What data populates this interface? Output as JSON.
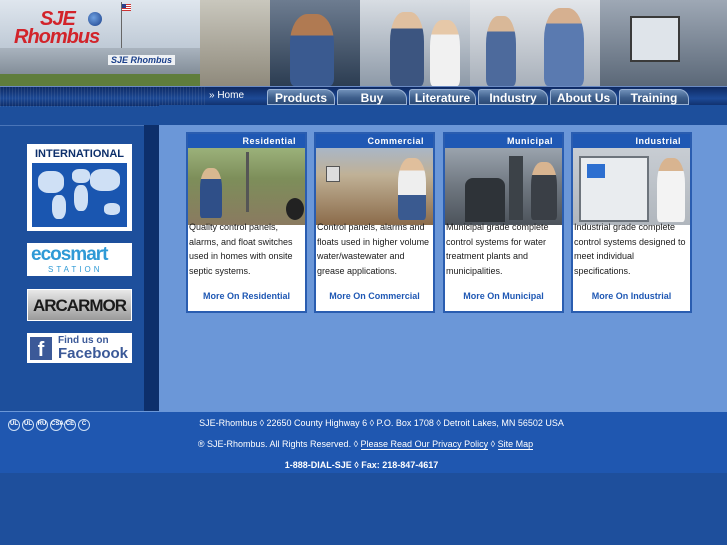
{
  "header": {
    "logo_line1": "SJE",
    "logo_line2": "Rhombus",
    "building_sign": "SJE Rhombus"
  },
  "nav": {
    "home": "» Home",
    "tabs": [
      {
        "label": "Products"
      },
      {
        "label": "Buy"
      },
      {
        "label": "Literature"
      },
      {
        "label": "Industry Info"
      },
      {
        "label": "About Us"
      },
      {
        "label": "Training"
      }
    ]
  },
  "sidebar": {
    "international": "INTERNATIONAL",
    "ecosmart": "ecosmart",
    "ecosmart_sub": "STATION",
    "arcarmor": "ARCARMOR",
    "facebook_f": "f",
    "facebook_findus": "Find us on",
    "facebook_name": "Facebook"
  },
  "cards": [
    {
      "title": "Residential",
      "text": "Quality control panels, alarms, and float switches used in homes with onsite septic systems.",
      "link": "More On Residential"
    },
    {
      "title": "Commercial",
      "text": "Control panels, alarms and floats used in higher volume water/wastewater and grease applications.",
      "link": "More On Commercial"
    },
    {
      "title": "Municipal",
      "text": "Municipal grade complete control systems for water treatment plants and municipalities.",
      "link": "More On Municipal"
    },
    {
      "title": "Industrial",
      "text": "Industrial grade complete control systems designed to meet individual specifications.",
      "link": "More On Industrial"
    }
  ],
  "footer": {
    "address": "SJE-Rhombus ◊ 22650 County Highway 6 ◊ P.O. Box 1708 ◊ Detroit Lakes, MN 56502 USA",
    "rights": "® SJE-Rhombus. All Rights Reserved. ◊",
    "privacy_link": "Please Read Our Privacy Policy",
    "sep": "◊",
    "sitemap_link": "Site Map",
    "phone": "1-888-DIAL-SJE ◊ Fax: 218-847-4617",
    "certs": [
      "UL",
      "UL",
      "RU",
      "CSA",
      "CE",
      "C"
    ]
  },
  "colors": {
    "brand_red": "#d2232a",
    "nav_blue": "#1d4a96",
    "content_blue": "#6b97d8",
    "card_header": "#1f58b4"
  }
}
